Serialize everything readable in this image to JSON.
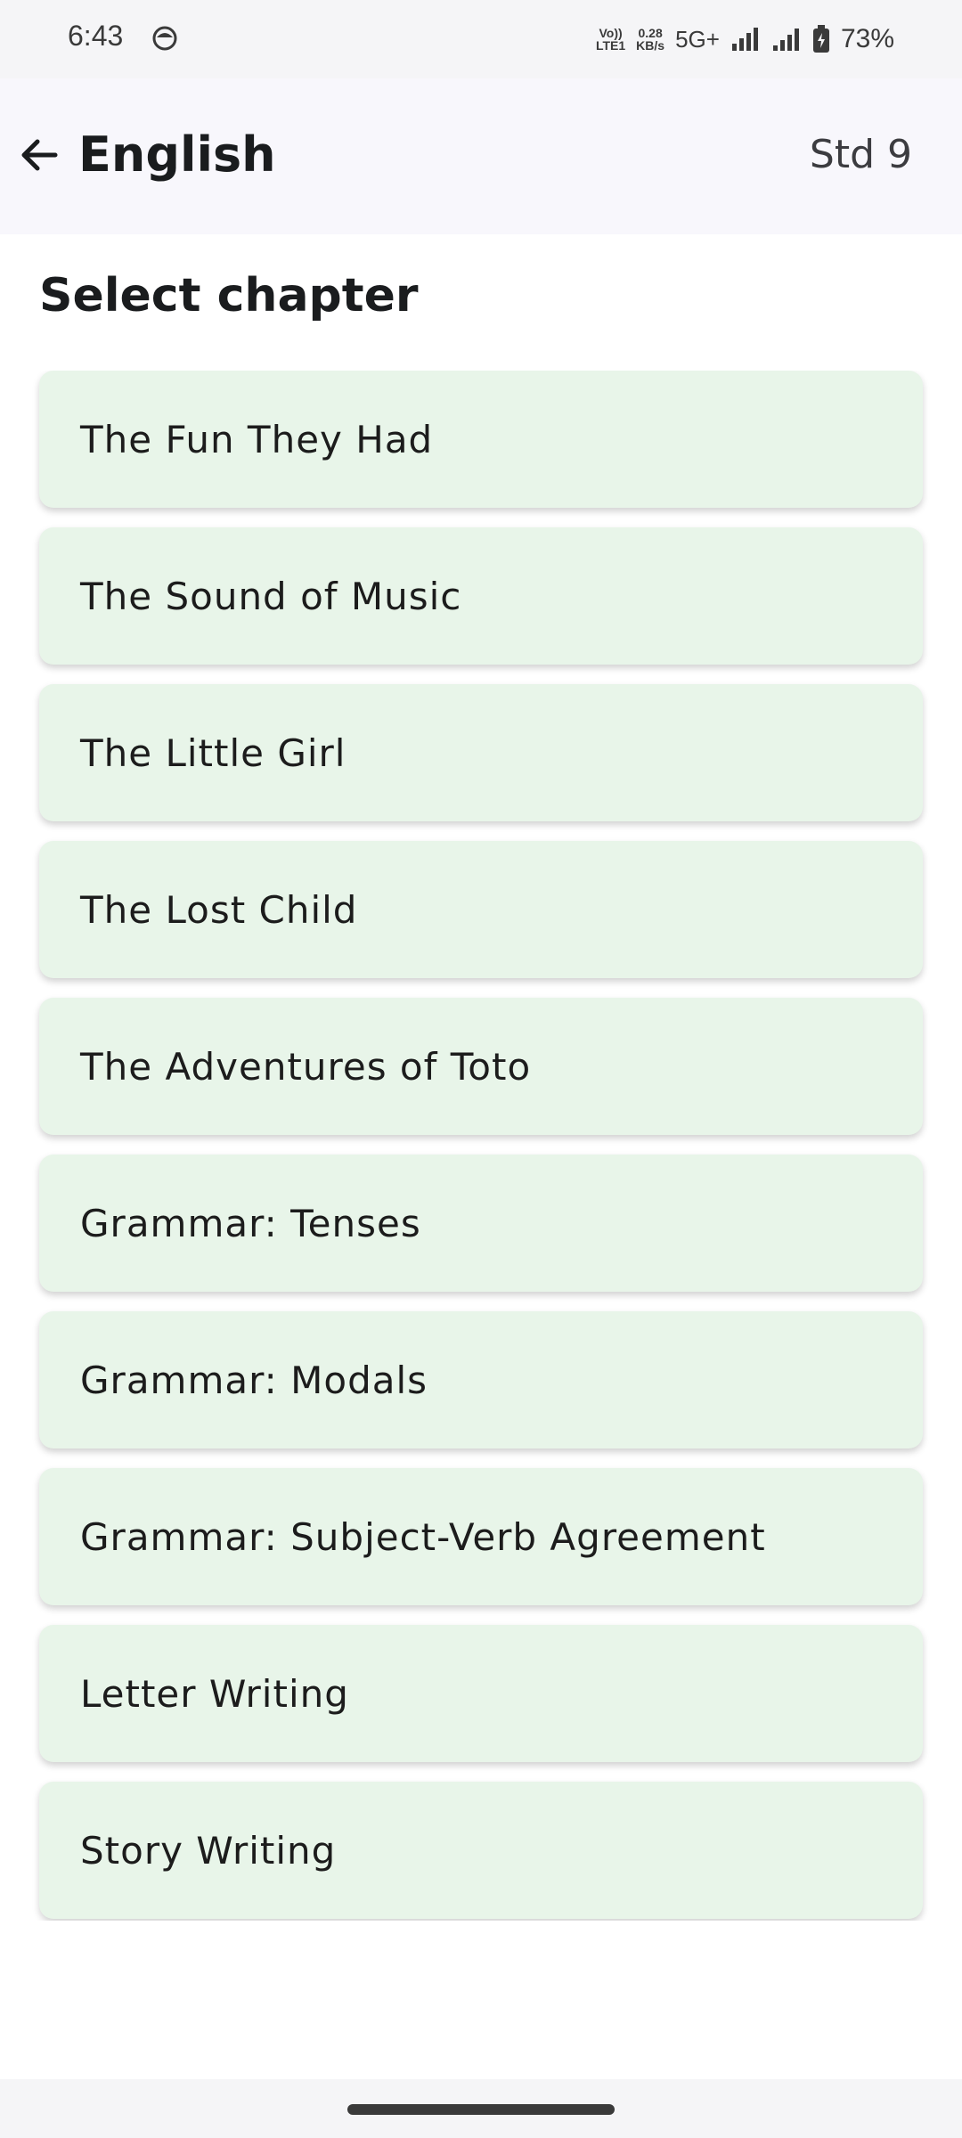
{
  "status_bar": {
    "time": "6:43",
    "volte": "Vo))",
    "lte": "LTE1",
    "speed_value": "0.28",
    "speed_unit": "KB/s",
    "network": "5G+",
    "battery": "73%"
  },
  "app_bar": {
    "title": "English",
    "standard": "Std 9"
  },
  "section": {
    "title": "Select chapter"
  },
  "chapters": [
    {
      "label": "The Fun They Had"
    },
    {
      "label": "The Sound of Music"
    },
    {
      "label": "The Little Girl"
    },
    {
      "label": "The Lost Child"
    },
    {
      "label": "The Adventures of Toto"
    },
    {
      "label": "Grammar: Tenses"
    },
    {
      "label": "Grammar: Modals"
    },
    {
      "label": "Grammar: Subject-Verb Agreement"
    },
    {
      "label": "Letter Writing"
    },
    {
      "label": "Story Writing"
    }
  ],
  "colors": {
    "card_background": "#e8f5e9",
    "app_bar_background": "#f8f7fc",
    "text_primary": "#1a1c1e"
  }
}
